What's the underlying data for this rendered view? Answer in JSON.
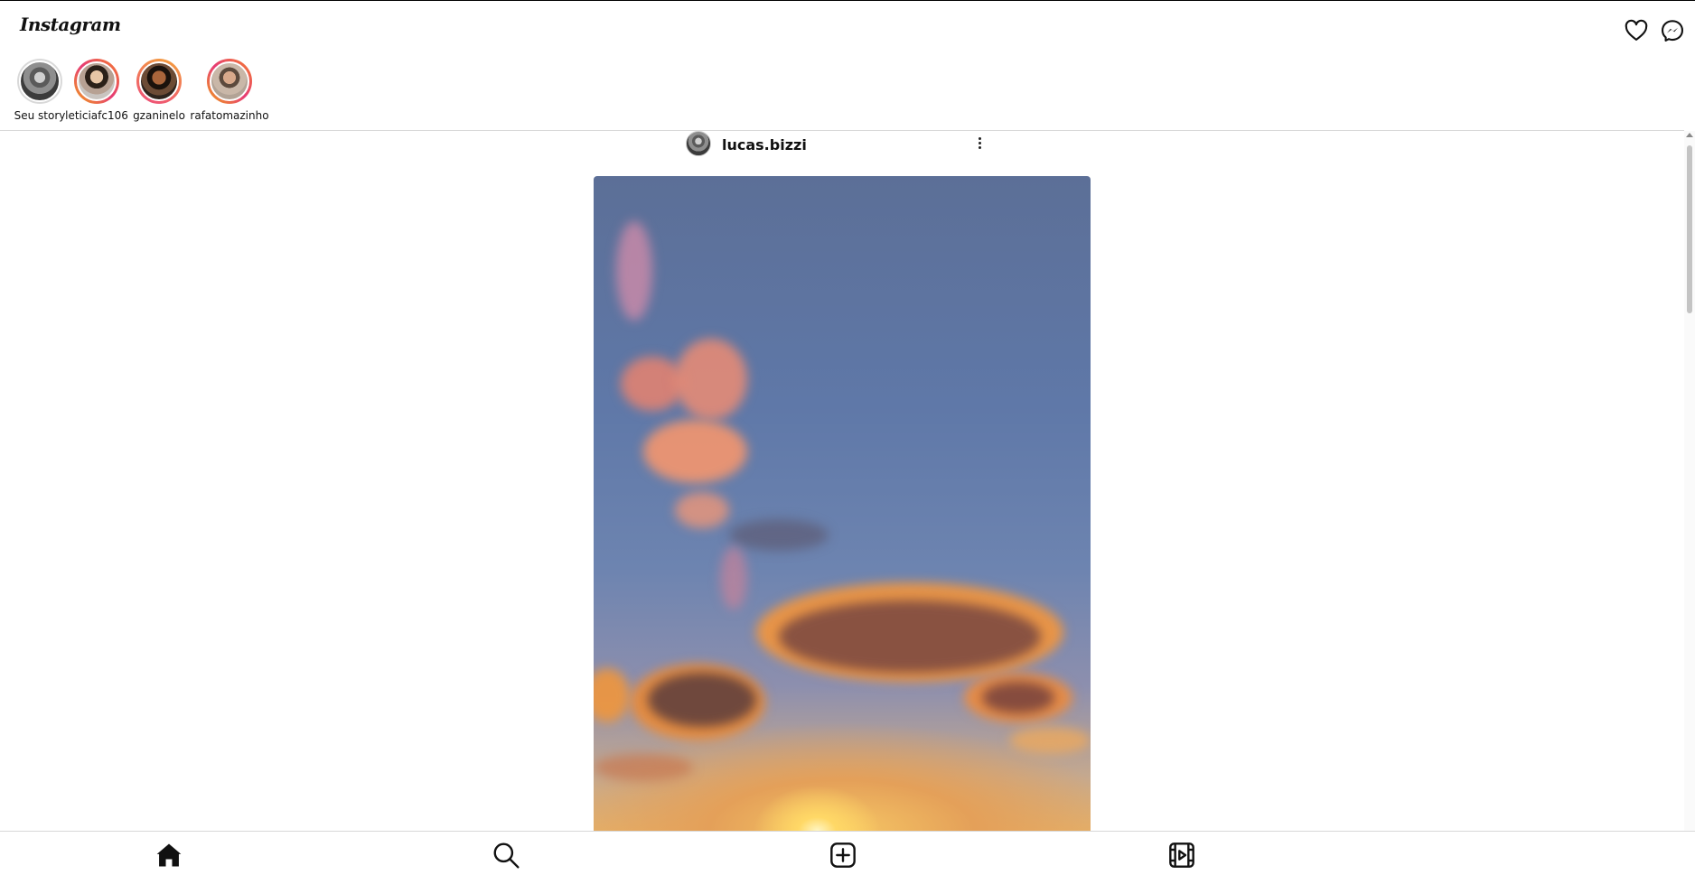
{
  "app": {
    "logo": "Instagram"
  },
  "header": {
    "icons": [
      "heart-icon",
      "messenger-icon"
    ]
  },
  "stories": [
    {
      "username": "Seu story",
      "ring": "none"
    },
    {
      "username": "leticiafc106",
      "ring": "gradient"
    },
    {
      "username": "gzaninelo",
      "ring": "gradient"
    },
    {
      "username": "rafatomazinho",
      "ring": "gradient"
    }
  ],
  "post": {
    "username": "lucas.bizzi",
    "more_icon": "more-vertical-icon",
    "image": "sunset-sky"
  },
  "bottom_nav": {
    "items": [
      "home-icon",
      "search-icon",
      "new-post-icon",
      "reels-icon"
    ]
  },
  "colors": {
    "story_ring_start": "#f1a01a",
    "story_ring_end": "#e63b75",
    "divider": "#d8d8d8"
  }
}
